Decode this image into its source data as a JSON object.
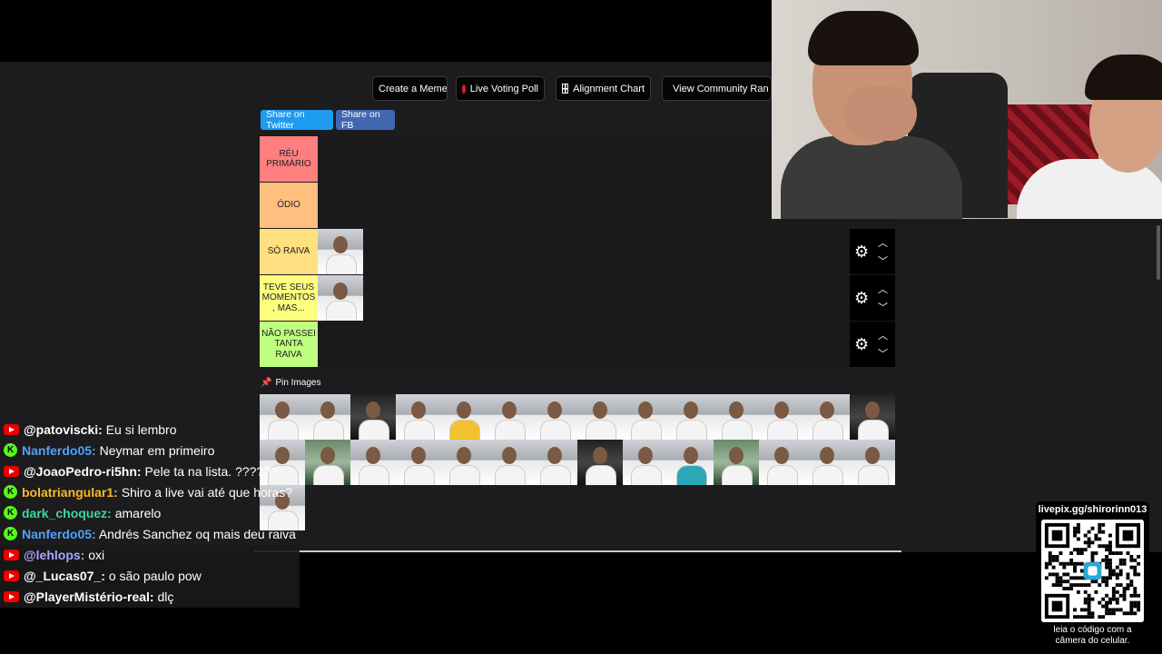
{
  "toolbar": {
    "create_meme": "Create a Meme",
    "live_poll": "Live Voting Poll",
    "alignment": "Alignment Chart",
    "community": "View Community Ran"
  },
  "share": {
    "twitter": "Share on Twitter",
    "facebook": "Share on FB"
  },
  "tiers": [
    {
      "label": "RÉU PRIMÁRIO",
      "color": "#ff7f7f",
      "items": 0
    },
    {
      "label": "ÓDIO",
      "color": "#ffbf7f",
      "items": 0
    },
    {
      "label": "SÓ RAIVA",
      "color": "#ffdf7f",
      "items": 1
    },
    {
      "label": "TEVE SEUS MOMENTOS , MAS...",
      "color": "#ffff7f",
      "items": 1
    },
    {
      "label": "NÃO PASSEI TANTA RAIVA",
      "color": "#bfff7f",
      "items": 0
    }
  ],
  "pin_images": "Pin Images",
  "pool_count": 29,
  "chat": [
    {
      "platform": "youtube",
      "user": "@patoviscki:",
      "text": "Eu si lembro",
      "color": "#ffffff"
    },
    {
      "platform": "kick",
      "user": "Nanferdo05:",
      "text": "Neymar em primeiro",
      "color": "#4fa3ff"
    },
    {
      "platform": "youtube",
      "user": "@JoaoPedro-ri5hn:",
      "text": "Pele ta na lista. ??????",
      "color": "#ffffff"
    },
    {
      "platform": "kick",
      "user": "bolatriangular1:",
      "text": "Shiro a live vai até que horas?",
      "color": "#ffb829"
    },
    {
      "platform": "kick",
      "user": "dark_choquez:",
      "text": "amarelo",
      "color": "#3fd6a0"
    },
    {
      "platform": "kick",
      "user": "Nanferdo05:",
      "text": "Andrés Sanchez oq mais deu raiva",
      "color": "#4fa3ff"
    },
    {
      "platform": "youtube",
      "user": "@lehlops:",
      "text": "oxi",
      "color": "#a9a6ff"
    },
    {
      "platform": "youtube",
      "user": "@_Lucas07_:",
      "text": "o são paulo pow",
      "color": "#ffffff"
    },
    {
      "platform": "youtube",
      "user": "@PlayerMistério-real:",
      "text": "dlç",
      "color": "#ffffff"
    }
  ],
  "qr": {
    "url": "livepix.gg/shirorinn013",
    "caption1": "leia o código com a",
    "caption2": "câmera do celular."
  }
}
